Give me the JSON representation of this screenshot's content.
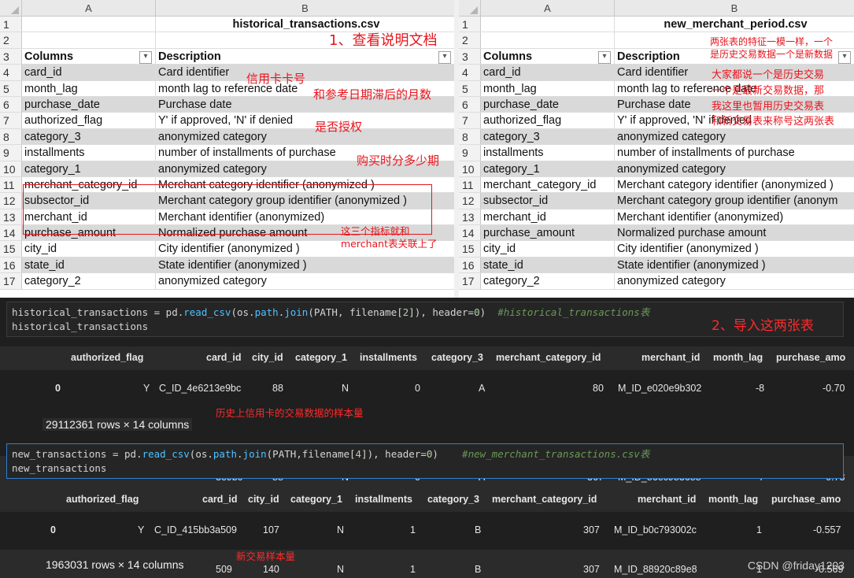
{
  "left_sheet": {
    "col_a": "A",
    "col_b": "B",
    "rows": [
      {
        "n": "1",
        "a": "",
        "b": "historical_transactions.csv"
      },
      {
        "n": "2",
        "a": "",
        "b": ""
      },
      {
        "n": "3",
        "a": "Columns",
        "b": "Description"
      },
      {
        "n": "4",
        "a": "card_id",
        "b": "Card identifier"
      },
      {
        "n": "5",
        "a": "month_lag",
        "b": "month lag to reference date"
      },
      {
        "n": "6",
        "a": "purchase_date",
        "b": "Purchase date"
      },
      {
        "n": "7",
        "a": "authorized_flag",
        "b": "Y' if approved, 'N' if denied"
      },
      {
        "n": "8",
        "a": "category_3",
        "b": "anonymized category"
      },
      {
        "n": "9",
        "a": "installments",
        "b": "number of installments of purchase"
      },
      {
        "n": "10",
        "a": "category_1",
        "b": "anonymized category"
      },
      {
        "n": "11",
        "a": "merchant_category_id",
        "b": "Merchant category identifier (anonymized )"
      },
      {
        "n": "12",
        "a": "subsector_id",
        "b": "Merchant category group identifier (anonymized )"
      },
      {
        "n": "13",
        "a": "merchant_id",
        "b": "Merchant identifier (anonymized)"
      },
      {
        "n": "14",
        "a": "purchase_amount",
        "b": "Normalized purchase amount"
      },
      {
        "n": "15",
        "a": "city_id",
        "b": "City identifier (anonymized )"
      },
      {
        "n": "16",
        "a": "state_id",
        "b": "State identifier (anonymized )"
      },
      {
        "n": "17",
        "a": "category_2",
        "b": "anonymized category"
      }
    ]
  },
  "right_sheet": {
    "col_a": "A",
    "col_b": "B",
    "rows": [
      {
        "n": "1",
        "a": "",
        "b": "new_merchant_period.csv"
      },
      {
        "n": "2",
        "a": "",
        "b": ""
      },
      {
        "n": "3",
        "a": "Columns",
        "b": "Description"
      },
      {
        "n": "4",
        "a": "card_id",
        "b": "Card identifier"
      },
      {
        "n": "5",
        "a": "month_lag",
        "b": "month lag to reference date"
      },
      {
        "n": "6",
        "a": "purchase_date",
        "b": "Purchase date"
      },
      {
        "n": "7",
        "a": "authorized_flag",
        "b": "Y' if approved, 'N' if denied"
      },
      {
        "n": "8",
        "a": "category_3",
        "b": "anonymized category"
      },
      {
        "n": "9",
        "a": "installments",
        "b": "number of installments of purchase"
      },
      {
        "n": "10",
        "a": "category_1",
        "b": "anonymized category"
      },
      {
        "n": "11",
        "a": "merchant_category_id",
        "b": "Merchant category identifier (anonymized )"
      },
      {
        "n": "12",
        "a": "subsector_id",
        "b": "Merchant category group identifier (anonym"
      },
      {
        "n": "13",
        "a": "merchant_id",
        "b": "Merchant identifier (anonymized)"
      },
      {
        "n": "14",
        "a": "purchase_amount",
        "b": "Normalized purchase amount"
      },
      {
        "n": "15",
        "a": "city_id",
        "b": "City identifier (anonymized )"
      },
      {
        "n": "16",
        "a": "state_id",
        "b": "State identifier (anonymized )"
      },
      {
        "n": "17",
        "a": "category_2",
        "b": "anonymized category"
      }
    ]
  },
  "annotations": {
    "step1": "1、查看说明文档",
    "card": "信用卡卡号",
    "month": "和参考日期滞后的月数",
    "auth": "是否授权",
    "install": "购买时分多少期",
    "merchant_link_1": "这三个指标就和",
    "merchant_link_2": "merchant表关联上了",
    "right_1": "两张表的特征一模一样，一个",
    "right_2": "是历史交易数据一个是新数据",
    "right_3": "大家都说一个是历史交易",
    "right_4": "一个是最新交易数据，那",
    "right_5": "我这里也暂用历史交易表",
    "right_6": "和新交易表来称号这两张表",
    "step2": "2、导入这两张表",
    "hist_note": "历史上信用卡的交易数据的样本量",
    "new_note": "新交易样本量"
  },
  "code1": {
    "var": "historical_transactions",
    "eq": " = ",
    "mod": "pd.",
    "fn1": "read_csv",
    "p1": "(os.",
    "fn2": "path",
    "p2": ".",
    "fn3": "join",
    "args": "(PATH, filename[",
    "idx": "2",
    "args2": "]), header=",
    "zero": "0",
    "close": ")",
    "comment": "#historical_transactions表",
    "line2": "historical_transactions"
  },
  "code2": {
    "var": "new_transactions",
    "eq": " = ",
    "mod": "pd.",
    "fn1": "read_csv",
    "p1": "(os.",
    "fn2": "path",
    "p2": ".",
    "fn3": "join",
    "args": "(PATH,filename[",
    "idx": "4",
    "args2": "]), header=",
    "zero": "0",
    "close": ")",
    "comment": "#new_merchant_transactions.csv表",
    "line2": "new_transactions"
  },
  "table1": {
    "headers": [
      "authorized_flag",
      "card_id",
      "city_id",
      "category_1",
      "installments",
      "category_3",
      "merchant_category_id",
      "merchant_id",
      "month_lag",
      "purchase_amo"
    ],
    "row0": [
      "0",
      "Y",
      "C_ID_4e6213e9bc",
      "88",
      "N",
      "0",
      "A",
      "80",
      "M_ID_e020e9b302",
      "-8",
      "-0.70"
    ],
    "row_last": [
      "3e9bc",
      "88",
      "N",
      "0",
      "A",
      "367",
      "M_ID_86ec983688",
      "-7",
      "-0.73"
    ],
    "shape": "29112361 rows × 14 columns"
  },
  "table2": {
    "headers": [
      "authorized_flag",
      "card_id",
      "city_id",
      "category_1",
      "installments",
      "category_3",
      "merchant_category_id",
      "merchant_id",
      "month_lag",
      "purchase_amo"
    ],
    "row0": [
      "0",
      "Y",
      "C_ID_415bb3a509",
      "107",
      "N",
      "1",
      "B",
      "307",
      "M_ID_b0c793002c",
      "1",
      "-0.557"
    ],
    "row_last": [
      "509",
      "140",
      "N",
      "1",
      "B",
      "307",
      "M_ID_88920c89e8",
      "1",
      "-0.569"
    ],
    "shape": "1963031 rows × 14 columns"
  },
  "watermark": "CSDN @friday1203",
  "colors": {
    "annotation": "#e8141c",
    "notebook_bg": "#1f1f1f",
    "active_border": "#2f7fd1"
  }
}
